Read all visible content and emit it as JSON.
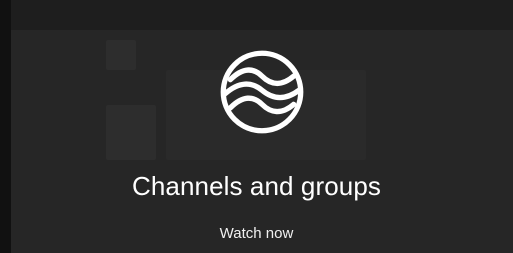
{
  "promo": {
    "title": "Channels and groups",
    "action_label": "Watch now",
    "icon": "wave-circle-icon"
  },
  "colors": {
    "background": "#262626",
    "top_strip": "#1e1e1e",
    "text": "#ffffff"
  }
}
